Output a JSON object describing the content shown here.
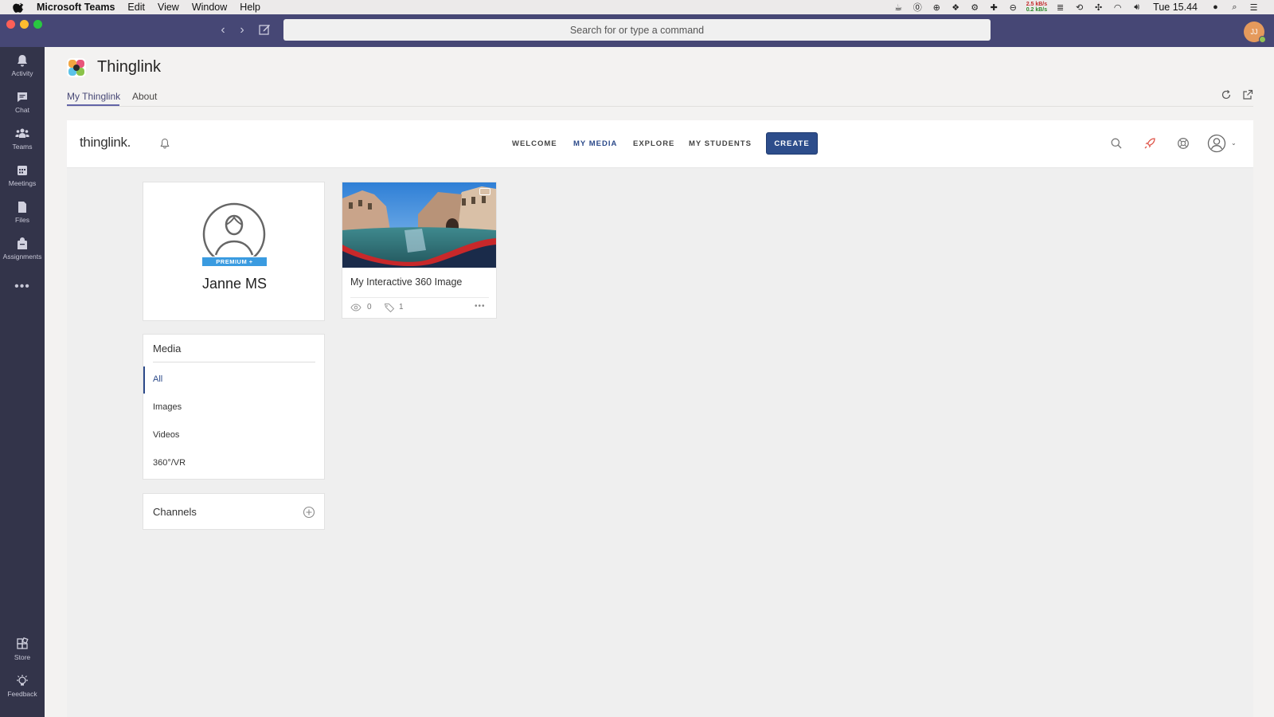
{
  "mac_menubar": {
    "app_name": "Microsoft Teams",
    "menus": [
      "Edit",
      "View",
      "Window",
      "Help"
    ],
    "net_up": "2.5 kB/s",
    "net_down": "0.2 kB/s",
    "clock": "Tue 15.44"
  },
  "teams_titlebar": {
    "search_placeholder": "Search for or type a command",
    "avatar_initials": "JJ"
  },
  "rail": {
    "items": [
      {
        "label": "Activity",
        "icon": "bell-icon"
      },
      {
        "label": "Chat",
        "icon": "chat-icon"
      },
      {
        "label": "Teams",
        "icon": "teams-icon"
      },
      {
        "label": "Meetings",
        "icon": "calendar-icon"
      },
      {
        "label": "Files",
        "icon": "file-icon"
      },
      {
        "label": "Assignments",
        "icon": "backpack-icon"
      }
    ],
    "more": "•••",
    "bottom": [
      {
        "label": "Store",
        "icon": "store-icon"
      },
      {
        "label": "Feedback",
        "icon": "lightbulb-icon"
      }
    ]
  },
  "app_header": {
    "title": "Thinglink",
    "tabs": [
      {
        "label": "My Thinglink",
        "active": true
      },
      {
        "label": "About",
        "active": false
      }
    ]
  },
  "thinglink": {
    "logo": "thinglink.",
    "nav": [
      {
        "label": "WELCOME",
        "active": false
      },
      {
        "label": "MY MEDIA",
        "active": true
      },
      {
        "label": "EXPLORE",
        "active": false
      },
      {
        "label": "MY STUDENTS",
        "active": false
      }
    ],
    "create_label": "CREATE",
    "accent_color": "#2d4d8b",
    "profile": {
      "badge": "PREMIUM +",
      "name": "Janne MS"
    },
    "media_filter": {
      "title": "Media",
      "options": [
        "All",
        "Images",
        "Videos",
        "360°/VR"
      ],
      "selected": "All"
    },
    "channels": {
      "title": "Channels"
    },
    "items": [
      {
        "title": "My Interactive 360 Image",
        "views": "0",
        "tags": "1",
        "more": "•••"
      }
    ]
  }
}
